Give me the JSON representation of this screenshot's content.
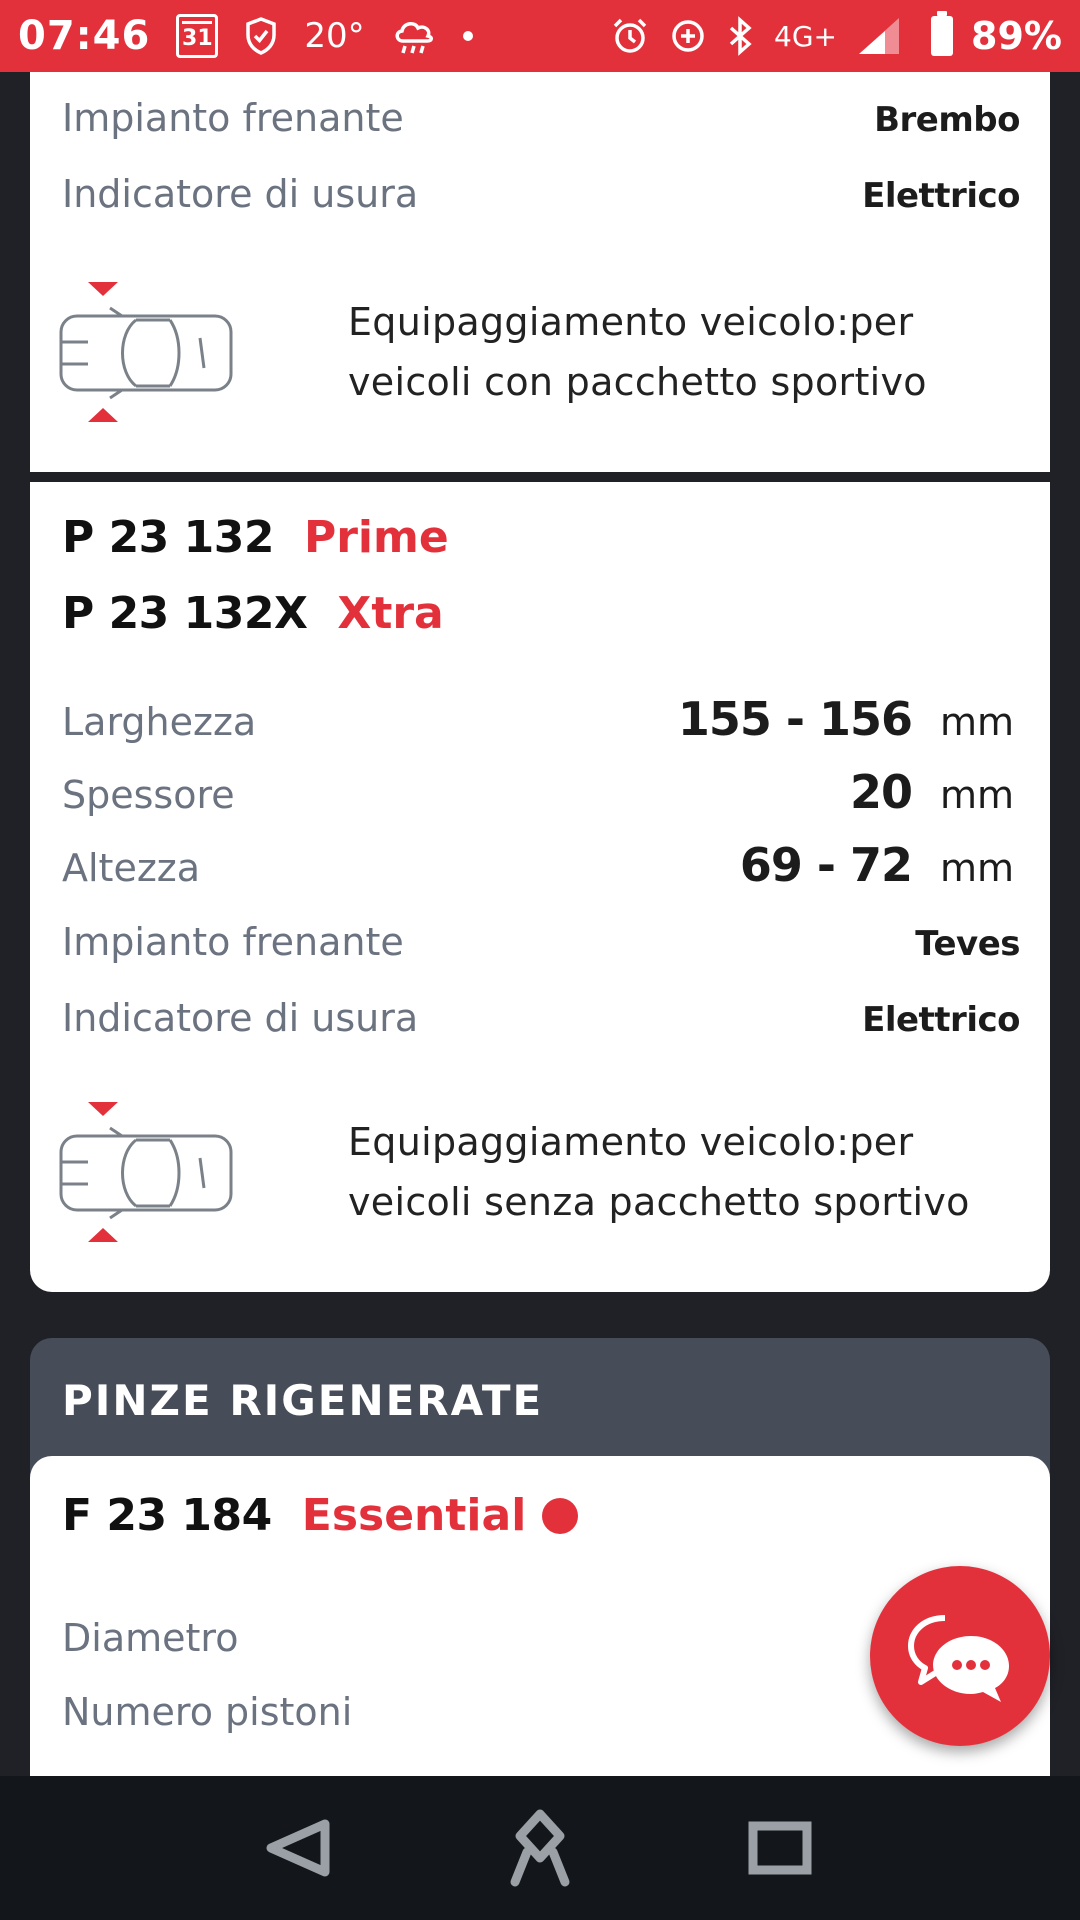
{
  "status_bar": {
    "time": "07:46",
    "calendar_day": "31",
    "temperature": "20°",
    "network": "4G+",
    "battery": "89%"
  },
  "card_top": {
    "specs": [
      {
        "label": "Impianto frenante",
        "value": "Brembo"
      },
      {
        "label": "Indicatore di usura",
        "value": "Elettrico"
      }
    ],
    "equipment_line1": "Equipaggiamento veicolo:per",
    "equipment_line2": "veicoli con pacchetto sportivo"
  },
  "card_main": {
    "products": [
      {
        "code": "P 23 132",
        "line": "Prime"
      },
      {
        "code": "P 23 132X",
        "line": "Xtra"
      }
    ],
    "dimensions": [
      {
        "label": "Larghezza",
        "value": "155 - 156",
        "unit": "mm"
      },
      {
        "label": "Spessore",
        "value": "20",
        "unit": "mm"
      },
      {
        "label": "Altezza",
        "value": "69 - 72",
        "unit": "mm"
      }
    ],
    "specs": [
      {
        "label": "Impianto frenante",
        "value": "Teves"
      },
      {
        "label": "Indicatore di usura",
        "value": "Elettrico"
      }
    ],
    "equipment_line1": "Equipaggiamento veicolo:per",
    "equipment_line2": "veicoli senza pacchetto sportivo"
  },
  "section": {
    "title": "PINZE RIGENERATE"
  },
  "card_calipers": {
    "code": "F 23 184",
    "line": "Essential",
    "specs": [
      {
        "label": "Diametro"
      },
      {
        "label": "Numero pistoni"
      }
    ]
  },
  "colors": {
    "accent": "#e3313c",
    "background": "#1f2127",
    "section_header": "#464c58",
    "label": "#6b7280"
  },
  "icons": {
    "fab": "chat-icon",
    "nav": [
      "back-icon",
      "home-icon",
      "recents-icon"
    ]
  }
}
